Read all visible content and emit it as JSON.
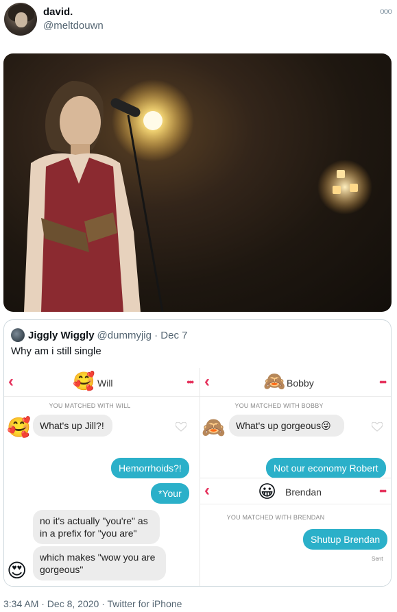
{
  "tweet": {
    "display_name": "david.",
    "handle": "@meltdouwn",
    "timestamp": "3:34 AM · Dec 8, 2020 · Twitter for iPhone"
  },
  "quote": {
    "display_name": "Jiggly Wiggly",
    "handle_date": "@dummyjig · Dec 7",
    "text": "Why am i still single"
  },
  "chats": {
    "will": {
      "name": "Will",
      "matched": "YOU MATCHED WITH WILL",
      "avatar_emoji": "🥰",
      "messages_in": [
        "What's up Jill?!",
        "no it's actually \"you're\" as in a prefix for \"you are\"",
        "which makes \"wow you are gorgeous\""
      ],
      "messages_out": [
        "Hemorrhoids?!",
        "*Your"
      ],
      "reply_emoji": "😍"
    },
    "bobby": {
      "name": "Bobby",
      "matched": "YOU MATCHED WITH BOBBY",
      "avatar_emoji": "🙈",
      "messages_in": [
        "What's up gorgeous😜"
      ],
      "messages_out": [
        "Not our economy Robert"
      ]
    },
    "brendan": {
      "name": "Brendan",
      "matched": "YOU MATCHED WITH BRENDAN",
      "avatar_emoji": "😀",
      "messages_out": [
        "Shutup Brendan"
      ],
      "status": "Sent"
    }
  },
  "icons": {
    "back": "‹",
    "more": "•••",
    "tweet_more": "ooo"
  },
  "colors": {
    "accent": "#e5335d",
    "bubble_out": "#2bb0c9",
    "bubble_in": "#ececec"
  }
}
